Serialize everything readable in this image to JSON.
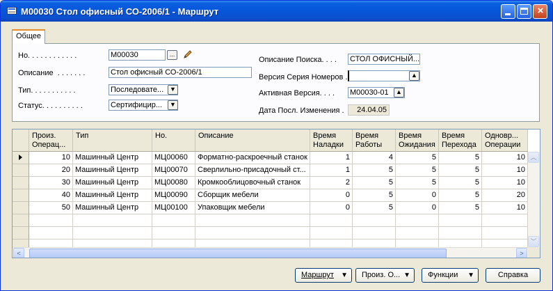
{
  "window": {
    "title": "M00030 Стол офисный СО-2006/1 - Маршрут"
  },
  "tabs": [
    {
      "label": "Общее"
    }
  ],
  "form": {
    "no_label": "Но. . . . . . . . . . . .",
    "no_value": "M00030",
    "lookup_glyph": "...",
    "description_label": "Описание  . . . . . . .",
    "description_value": "Стол офисный СО-2006/1",
    "type_label": "Тип. . . . . . . . . . .",
    "type_value": "Последовате...",
    "status_label": "Статус. . . . . . . . . .",
    "status_value": "Сертифицир...",
    "search_desc_label": "Описание Поиска. . . .",
    "search_desc_value": "СТОЛ ОФИСНЫЙ...",
    "series_label": "Версия Серия Номеров .",
    "series_value": "",
    "active_version_label": "Активная Версия. . . .",
    "active_version_value": "M00030-01",
    "last_modified_label": "Дата Посл. Изменения .",
    "last_modified_value": "24.04.05"
  },
  "table": {
    "columns": [
      {
        "key": "op",
        "label": "Произ.\nОперац..."
      },
      {
        "key": "type",
        "label": "Тип"
      },
      {
        "key": "no",
        "label": "Но."
      },
      {
        "key": "desc",
        "label": "Описание"
      },
      {
        "key": "setup",
        "label": "Время\nНаладки"
      },
      {
        "key": "run",
        "label": "Время\nРаботы"
      },
      {
        "key": "wait",
        "label": "Время\nОжидания"
      },
      {
        "key": "move",
        "label": "Время\nПерехода"
      },
      {
        "key": "concurrent",
        "label": "Одновр...\nОперации"
      }
    ],
    "rows": [
      {
        "op": "10",
        "type": "Машинный Центр",
        "no": "МЦ00060",
        "desc": "Форматно-раскроечный станок",
        "setup": "1",
        "run": "4",
        "wait": "5",
        "move": "5",
        "concurrent": "10"
      },
      {
        "op": "20",
        "type": "Машинный Центр",
        "no": "МЦ00070",
        "desc": "Сверлильно-присадочный ст...",
        "setup": "1",
        "run": "5",
        "wait": "5",
        "move": "5",
        "concurrent": "10"
      },
      {
        "op": "30",
        "type": "Машинный Центр",
        "no": "МЦ00080",
        "desc": "Кромкооблицовочный станок",
        "setup": "2",
        "run": "5",
        "wait": "5",
        "move": "5",
        "concurrent": "10"
      },
      {
        "op": "40",
        "type": "Машинный Центр",
        "no": "МЦ00090",
        "desc": "Сборщик мебели",
        "setup": "0",
        "run": "5",
        "wait": "0",
        "move": "5",
        "concurrent": "20"
      },
      {
        "op": "50",
        "type": "Машинный Центр",
        "no": "МЦ00100",
        "desc": "Упаковщик мебели",
        "setup": "0",
        "run": "5",
        "wait": "0",
        "move": "5",
        "concurrent": "10"
      }
    ],
    "empty_rows": 3
  },
  "buttons": {
    "route": "Маршрут",
    "prod_op": "Произ. О...",
    "functions": "Функции",
    "help": "Справка"
  }
}
